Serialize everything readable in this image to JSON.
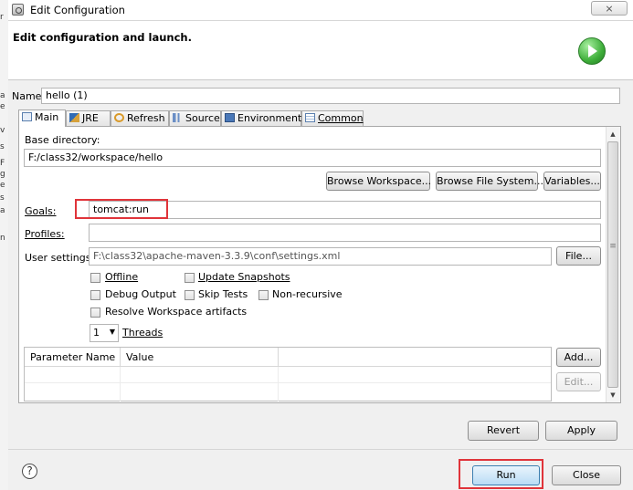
{
  "window": {
    "title": "Edit Configuration",
    "close_icon": "close-icon"
  },
  "header": {
    "title": "Edit configuration and launch.",
    "icon": "run-icon"
  },
  "left_strip": {
    "letters": [
      "r",
      "a",
      "e",
      "v",
      "s",
      "F",
      "g",
      "e",
      "s",
      "a",
      "n"
    ]
  },
  "name": {
    "label": "Name:",
    "value": "hello (1)"
  },
  "tabs": [
    {
      "label": "Main",
      "icon": "main-icon",
      "active": true
    },
    {
      "label": "JRE",
      "icon": "jre-icon"
    },
    {
      "label": "Refresh",
      "icon": "refresh-icon"
    },
    {
      "label": "Source",
      "icon": "source-icon"
    },
    {
      "label": "Environment",
      "icon": "environment-icon"
    },
    {
      "label": "Common",
      "icon": "common-icon"
    }
  ],
  "main": {
    "base_directory": {
      "label": "Base directory:",
      "value": "F:/class32/workspace/hello"
    },
    "buttons": {
      "browse_workspace": "Browse Workspace...",
      "browse_file_system": "Browse File System...",
      "variables": "Variables..."
    },
    "goals": {
      "label": "Goals:",
      "value": "tomcat:run"
    },
    "profiles": {
      "label": "Profiles:",
      "value": ""
    },
    "user_settings": {
      "label": "User settings:",
      "value": "F:\\class32\\apache-maven-3.3.9\\conf\\settings.xml",
      "file_button": "File..."
    },
    "checkboxes": {
      "offline": "Offline",
      "update_snapshots": "Update Snapshots",
      "debug_output": "Debug Output",
      "skip_tests": "Skip Tests",
      "non_recursive": "Non-recursive",
      "resolve_workspace": "Resolve Workspace artifacts"
    },
    "threads": {
      "value": "1",
      "label": "Threads"
    },
    "parameter_table": {
      "columns": [
        "Parameter Name",
        "Value"
      ],
      "add_button": "Add...",
      "edit_button": "Edit..."
    },
    "revert_button": "Revert",
    "apply_button": "Apply"
  },
  "footer": {
    "help_icon": "?",
    "run_button": "Run",
    "close_button": "Close"
  },
  "colors": {
    "highlight": "#e0343a",
    "run_icon": "#3eae3a"
  }
}
